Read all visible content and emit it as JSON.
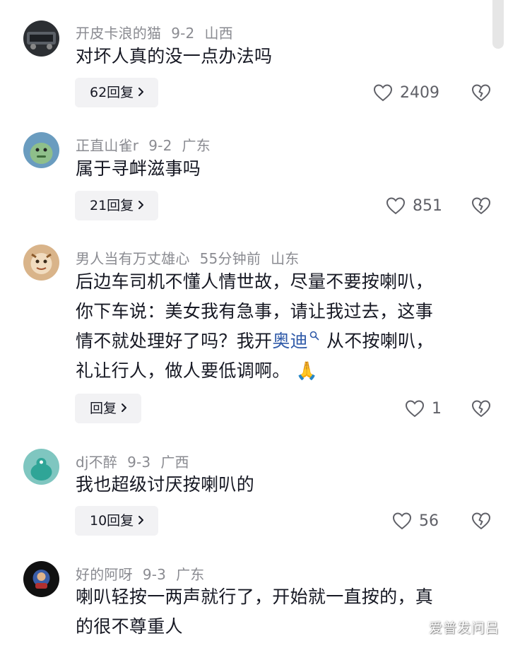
{
  "comments": [
    {
      "user": "开皮卡浪的猫",
      "date": "9-2",
      "location": "山西",
      "text": "对坏人真的没一点办法吗",
      "replies": "62回复",
      "likes": "2409"
    },
    {
      "user": "正直山雀r",
      "date": "9-2",
      "location": "广东",
      "text": "属于寻衅滋事吗",
      "replies": "21回复",
      "likes": "851"
    },
    {
      "user": "男人当有万丈雄心",
      "date": "55分钟前",
      "location": "山东",
      "text_line1": "后边车司机不懂人情世故，尽量不要按喇叭，",
      "text_line2": "你下车说：美女我有急事，请让我过去，这事",
      "text_line3_a": "情不就处理好了吗？我开",
      "text_line3_link": "奥迪",
      "text_line3_b": "从不按喇叭，",
      "text_line4": "礼让行人，做人要低调啊。",
      "emoji": "🙏",
      "replies": "回复",
      "likes": "1"
    },
    {
      "user": "dj不醉",
      "date": "9-3",
      "location": "广西",
      "text": "我也超级讨厌按喇叭的",
      "replies": "10回复",
      "likes": "56"
    },
    {
      "user": "好的阿呀",
      "date": "9-3",
      "location": "广东",
      "text_line1": "喇叭轻按一两声就行了，开始就一直按的，真",
      "text_line2": "的很不尊重人"
    }
  ],
  "watermark": "爱普发问吕",
  "colors": {
    "meta": "#8a8b91",
    "text": "#161823",
    "link": "#2f5aa8",
    "reply_bg": "#f2f2f4",
    "icon": "#5f6067"
  },
  "icons": [
    "heart-icon",
    "broken-heart-icon",
    "chevron-right-icon",
    "search-icon"
  ]
}
